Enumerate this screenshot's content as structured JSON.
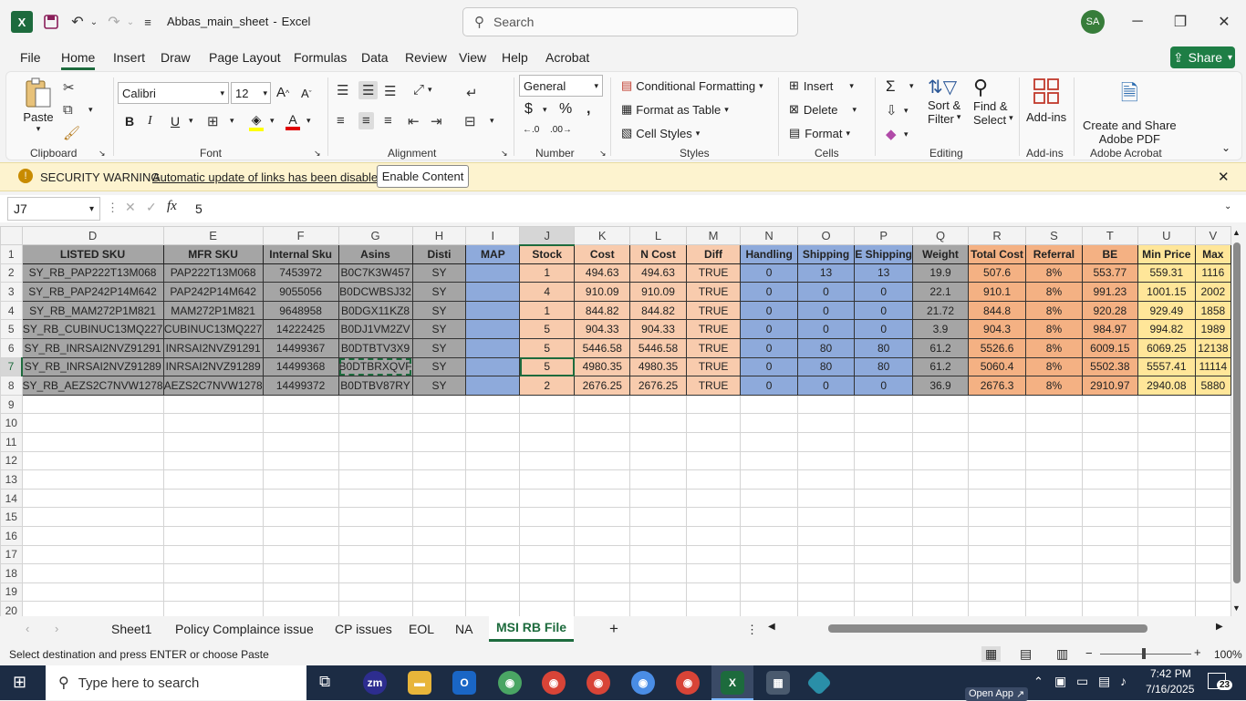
{
  "window": {
    "file_title": "Abbas_main_sheet",
    "app_name": "Excel",
    "title_sep": "-",
    "search_placeholder": "Search",
    "avatar_initials": "SA"
  },
  "menu": {
    "items": [
      "File",
      "Home",
      "Insert",
      "Draw",
      "Page Layout",
      "Formulas",
      "Data",
      "Review",
      "View",
      "Help",
      "Acrobat"
    ],
    "active": "Home",
    "share_label": "Share"
  },
  "ribbon": {
    "paste_label": "Paste",
    "font_name": "Calibri",
    "font_size": "12",
    "number_format": "General",
    "conditional_formatting": "Conditional Formatting",
    "format_as_table": "Format as Table",
    "cell_styles": "Cell Styles",
    "insert": "Insert",
    "delete": "Delete",
    "format": "Format",
    "sort_filter_1": "Sort &",
    "sort_filter_2": "Filter",
    "find_select_1": "Find &",
    "find_select_2": "Select",
    "addins": "Add-ins",
    "create_pdf_1": "Create and Share",
    "create_pdf_2": "Adobe PDF",
    "groups": {
      "clipboard": "Clipboard",
      "font": "Font",
      "alignment": "Alignment",
      "number": "Number",
      "styles": "Styles",
      "cells": "Cells",
      "editing": "Editing",
      "addins": "Add-ins",
      "adobe": "Adobe Acrobat"
    }
  },
  "security": {
    "title": "SECURITY WARNING",
    "message": "Automatic update of links has been disabled",
    "button": "Enable Content"
  },
  "formula_bar": {
    "name_box": "J7",
    "value": "5"
  },
  "columns": [
    "D",
    "E",
    "F",
    "G",
    "H",
    "I",
    "J",
    "K",
    "L",
    "M",
    "N",
    "O",
    "P",
    "Q",
    "R",
    "S",
    "T",
    "U",
    "V"
  ],
  "headers": [
    "LISTED SKU",
    "MFR SKU",
    "Internal Sku",
    "Asins",
    "Disti",
    "MAP",
    "Stock",
    "Cost",
    "N Cost",
    "Diff",
    "Handling",
    "Shipping",
    "E Shipping",
    "Weight",
    "Total Cost",
    "Referral",
    "BE",
    "Min Price",
    "Max"
  ],
  "rows": [
    [
      "SY_RB_PAP222T13M068",
      "PAP222T13M068",
      "7453972",
      "B0C7K3W457",
      "SY",
      "",
      "1",
      "494.63",
      "494.63",
      "TRUE",
      "0",
      "13",
      "13",
      "19.9",
      "507.6",
      "8%",
      "553.77",
      "559.31",
      "1116"
    ],
    [
      "SY_RB_PAP242P14M642",
      "PAP242P14M642",
      "9055056",
      "B0DCWBSJ32",
      "SY",
      "",
      "4",
      "910.09",
      "910.09",
      "TRUE",
      "0",
      "0",
      "0",
      "22.1",
      "910.1",
      "8%",
      "991.23",
      "1001.15",
      "2002"
    ],
    [
      "SY_RB_MAM272P1M821",
      "MAM272P1M821",
      "9648958",
      "B0DGX11KZ8",
      "SY",
      "",
      "1",
      "844.82",
      "844.82",
      "TRUE",
      "0",
      "0",
      "0",
      "21.72",
      "844.8",
      "8%",
      "920.28",
      "929.49",
      "1858"
    ],
    [
      "SY_RB_CUBINUC13MQ227",
      "CUBINUC13MQ227",
      "14222425",
      "B0DJ1VM2ZV",
      "SY",
      "",
      "5",
      "904.33",
      "904.33",
      "TRUE",
      "0",
      "0",
      "0",
      "3.9",
      "904.3",
      "8%",
      "984.97",
      "994.82",
      "1989"
    ],
    [
      "SY_RB_INRSAI2NVZ91291",
      "INRSAI2NVZ91291",
      "14499367",
      "B0DTBTV3X9",
      "SY",
      "",
      "5",
      "5446.58",
      "5446.58",
      "TRUE",
      "0",
      "80",
      "80",
      "61.2",
      "5526.6",
      "8%",
      "6009.15",
      "6069.25",
      "12138"
    ],
    [
      "SY_RB_INRSAI2NVZ91289",
      "INRSAI2NVZ91289",
      "14499368",
      "B0DTBRXQVF",
      "SY",
      "",
      "5",
      "4980.35",
      "4980.35",
      "TRUE",
      "0",
      "80",
      "80",
      "61.2",
      "5060.4",
      "8%",
      "5502.38",
      "5557.41",
      "11114"
    ],
    [
      "SY_RB_AEZS2C7NVW1278",
      "AEZS2C7NVW1278",
      "14499372",
      "B0DTBV87RY",
      "SY",
      "",
      "2",
      "2676.25",
      "2676.25",
      "TRUE",
      "0",
      "0",
      "0",
      "36.9",
      "2676.3",
      "8%",
      "2910.97",
      "2940.08",
      "5880"
    ]
  ],
  "empty_row_numbers": [
    "9",
    "10",
    "11",
    "12",
    "13",
    "14",
    "15",
    "16",
    "17",
    "18",
    "19",
    "20"
  ],
  "sheet_tabs": [
    "Sheet1",
    "Policy Complaince issue",
    "CP issues",
    "EOL",
    "NA",
    "MSI RB File"
  ],
  "active_tab": "MSI RB File",
  "status": {
    "message": "Select destination and press ENTER or choose Paste",
    "zoom": "100%"
  },
  "taskbar": {
    "search_placeholder": "Type here to search",
    "time": "7:42 PM",
    "date": "7/16/2025",
    "notification_count": "23",
    "open_app_hint": "Open App"
  },
  "colors": {
    "excel_green": "#1d6b3d",
    "gray_fill": "#a5a5a5",
    "blue_fill": "#8eaadb",
    "peach_fill": "#f8cbad",
    "orange_fill": "#f4b183",
    "yellow_fill": "#ffe699",
    "security_bar": "#fdf3cf",
    "taskbar": "#1c2c44"
  }
}
